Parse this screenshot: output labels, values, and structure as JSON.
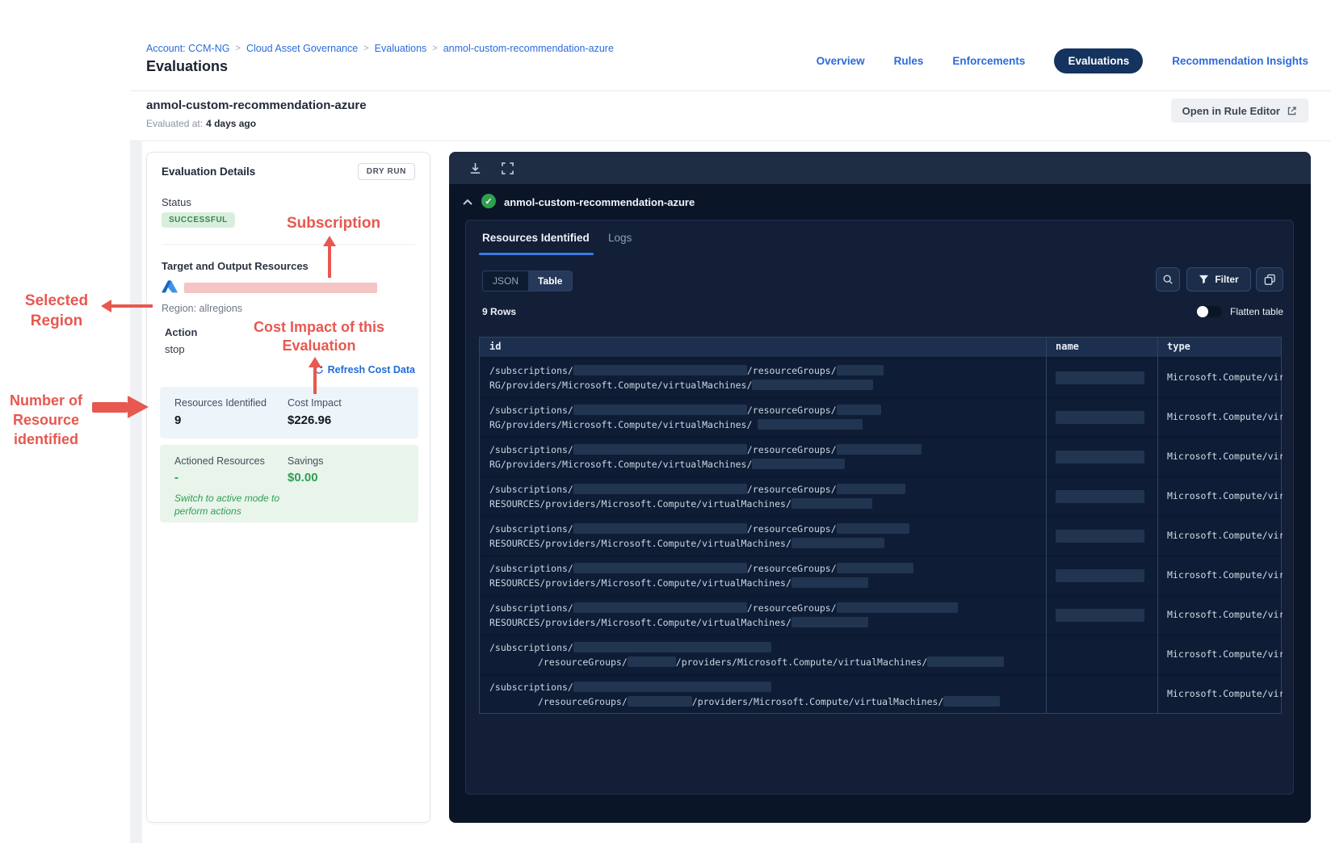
{
  "header": {
    "breadcrumb": [
      "Account: CCM-NG",
      "Cloud Asset Governance",
      "Evaluations",
      "anmol-custom-recommendation-azure"
    ],
    "page_title": "Evaluations",
    "nav_tabs": [
      {
        "label": "Overview",
        "active": false
      },
      {
        "label": "Rules",
        "active": false
      },
      {
        "label": "Enforcements",
        "active": false
      },
      {
        "label": "Evaluations",
        "active": true
      },
      {
        "label": "Recommendation Insights",
        "active": false
      }
    ]
  },
  "subheader": {
    "title": "anmol-custom-recommendation-azure",
    "evaluated_label": "Evaluated at:",
    "evaluated_value": "4 days ago",
    "open_rule_editor_label": "Open in Rule Editor"
  },
  "details": {
    "title": "Evaluation Details",
    "mode_badge": "DRY RUN",
    "status_label": "Status",
    "status_value": "SUCCESSFUL",
    "target_label": "Target and Output Resources",
    "region": "Region: allregions",
    "action_label": "Action",
    "action_value": "stop",
    "refresh_link": "Refresh Cost Data",
    "resources_identified_label": "Resources Identified",
    "resources_identified_value": "9",
    "cost_impact_label": "Cost Impact",
    "cost_impact_value": "$226.96",
    "actioned_label": "Actioned Resources",
    "actioned_value": "-",
    "savings_label": "Savings",
    "savings_value": "$0.00",
    "switch_note": [
      "Switch to active mode to",
      "perform actions"
    ]
  },
  "annotations": {
    "subscription": [
      "Subscription"
    ],
    "selected_region": [
      "Selected",
      "Region"
    ],
    "cost_impact": [
      "Cost Impact of this",
      "Evaluation"
    ],
    "num_resources": [
      "Number of",
      "Resource",
      "identified"
    ],
    "color": "#e75850"
  },
  "panel": {
    "run_title": "anmol-custom-recommendation-azure",
    "tabs": [
      "Resources Identified",
      "Logs"
    ],
    "view_toggle": [
      "JSON",
      "Table"
    ],
    "filter_label": "Filter",
    "rows_count": "9 Rows",
    "flatten_label": "Flatten table",
    "table": {
      "columns": [
        "id",
        "name",
        "type"
      ],
      "rows": [
        {
          "name_bar": true,
          "type": "Microsoft.Compute/virtu",
          "line1": [
            [
              "t",
              "/subscriptions/"
            ],
            [
              "r",
              215
            ],
            [
              "t",
              "/resourceGroups/"
            ],
            [
              "r",
              58
            ]
          ],
          "line2": [
            [
              "t",
              "RG/providers/Microsoft.Compute/virtualMachines/"
            ],
            [
              "r",
              150
            ]
          ]
        },
        {
          "name_bar": true,
          "type": "Microsoft.Compute/virtu",
          "line1": [
            [
              "t",
              "/subscriptions/"
            ],
            [
              "r",
              215
            ],
            [
              "t",
              "/resourceGroups/"
            ],
            [
              "r",
              55
            ]
          ],
          "line2": [
            [
              "t",
              "RG/providers/Microsoft.Compute/virtualMachines/ "
            ],
            [
              "r",
              130
            ]
          ]
        },
        {
          "name_bar": true,
          "type": "Microsoft.Compute/virtu",
          "line1": [
            [
              "t",
              "/subscriptions/"
            ],
            [
              "r",
              215
            ],
            [
              "t",
              "/resourceGroups/"
            ],
            [
              "r",
              105
            ]
          ],
          "line2": [
            [
              "t",
              "RG/providers/Microsoft.Compute/virtualMachines/"
            ],
            [
              "r",
              115
            ]
          ]
        },
        {
          "name_bar": true,
          "type": "Microsoft.Compute/virtu",
          "line1": [
            [
              "t",
              "/subscriptions/"
            ],
            [
              "r",
              215
            ],
            [
              "t",
              "/resourceGroups/"
            ],
            [
              "r",
              85
            ]
          ],
          "line2": [
            [
              "t",
              "RESOURCES/providers/Microsoft.Compute/virtualMachines/"
            ],
            [
              "r",
              100
            ]
          ]
        },
        {
          "name_bar": true,
          "type": "Microsoft.Compute/virtu",
          "line1": [
            [
              "t",
              "/subscriptions/"
            ],
            [
              "r",
              215
            ],
            [
              "t",
              "/resourceGroups/"
            ],
            [
              "r",
              90
            ]
          ],
          "line2": [
            [
              "t",
              "RESOURCES/providers/Microsoft.Compute/virtualMachines/"
            ],
            [
              "r",
              115
            ]
          ]
        },
        {
          "name_bar": true,
          "type": "Microsoft.Compute/virtu",
          "line1": [
            [
              "t",
              "/subscriptions/"
            ],
            [
              "r",
              215
            ],
            [
              "t",
              "/resourceGroups/"
            ],
            [
              "r",
              95
            ]
          ],
          "line2": [
            [
              "t",
              "RESOURCES/providers/Microsoft.Compute/virtualMachines/"
            ],
            [
              "r",
              95
            ]
          ]
        },
        {
          "name_bar": true,
          "type": "Microsoft.Compute/virtu",
          "line1": [
            [
              "t",
              "/subscriptions/"
            ],
            [
              "r",
              215
            ],
            [
              "t",
              "/resourceGroups/"
            ],
            [
              "r",
              150
            ]
          ],
          "line2": [
            [
              "t",
              "RESOURCES/providers/Microsoft.Compute/virtualMachines/"
            ],
            [
              "r",
              95
            ]
          ]
        },
        {
          "name_bar": false,
          "type": "Microsoft.Compute/virtu",
          "line1": [
            [
              "t",
              "/subscriptions/"
            ],
            [
              "r",
              245
            ]
          ],
          "line2": [
            [
              "s",
              60
            ],
            [
              "t",
              "/resourceGroups/"
            ],
            [
              "r",
              60
            ],
            [
              "t",
              "/providers/Microsoft.Compute/virtualMachines/"
            ],
            [
              "r",
              95
            ]
          ]
        },
        {
          "name_bar": false,
          "type": "Microsoft.Compute/virtu",
          "line1": [
            [
              "t",
              "/subscriptions/"
            ],
            [
              "r",
              245
            ]
          ],
          "line2": [
            [
              "s",
              60
            ],
            [
              "t",
              "/resourceGroups/"
            ],
            [
              "r",
              80
            ],
            [
              "t",
              "/providers/Microsoft.Compute/virtualMachines/"
            ],
            [
              "r",
              70
            ]
          ]
        }
      ]
    }
  },
  "icons": {
    "download": "tray-arrow-down",
    "fullscreen": "corner-brackets",
    "collapse": "chevron-up",
    "status": "check-circle",
    "search": "magnifier",
    "filter": "funnel",
    "copy": "overlapping-squares",
    "refresh": "circular-arrow",
    "external_link": "arrow-out-of-box",
    "azure": "azure-triangle"
  },
  "colors": {
    "annotation_red": "#e75850",
    "accent_blue": "#2b6bdb",
    "active_pill_navy": "#14335f",
    "success_green": "#2f9e52",
    "panel_navy": "#0a1527",
    "redaction_pink": "#f4c5c4"
  }
}
